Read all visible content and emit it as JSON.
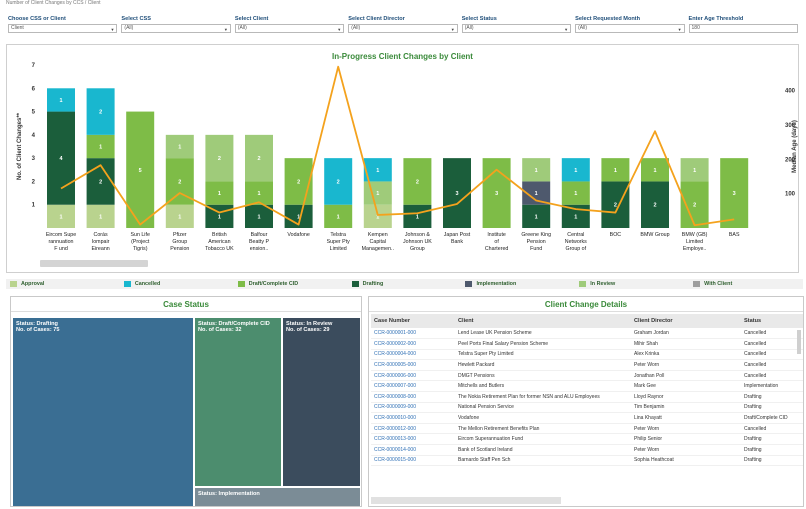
{
  "header": {
    "note": "Number of Client Changes by CCS / Client"
  },
  "filters": [
    {
      "label": "Choose CSS or Client",
      "value": "Client"
    },
    {
      "label": "Select CSS",
      "value": "(All)"
    },
    {
      "label": "Select Client",
      "value": "(All)"
    },
    {
      "label": "Select Client Director",
      "value": "(All)"
    },
    {
      "label": "Select Status",
      "value": "(All)"
    },
    {
      "label": "Select Requested Month",
      "value": "(All)"
    },
    {
      "label": "Enter Age Threshold",
      "value": "180"
    }
  ],
  "chart_data": {
    "type": "bar",
    "title": "In-Progress Client Changes by Client",
    "ylabel": "No. of Client Changes**",
    "y2label": "Median Age (days)",
    "ylim": [
      0,
      7
    ],
    "yticks": [
      1,
      2,
      3,
      4,
      5,
      6,
      7
    ],
    "y2lim": [
      0,
      475
    ],
    "y2ticks": [
      100,
      200,
      300,
      400
    ],
    "categories": [
      "Eircom Supe rannuation F und",
      "Corás Iompair Eireann",
      "Sun Life (Project Tigris)",
      "Pfizer Group Pension Scheme",
      "British American Tobacco UK",
      "Balfour Beatty P ension..",
      "Vodafone",
      "Telstra Super Pty Limited",
      "Kempen Capital Managemen..",
      "Johnson & Johnson UK Group Reti..",
      "Japan Post Bank",
      "Institute of Chartered Accountants",
      "Greene King Pension Fund",
      "Central Networks Group of th..",
      "BOC",
      "BMW Group",
      "BMW (GB) Limited Employe..",
      "BAS"
    ],
    "series": [
      {
        "name": "Approval",
        "color": "#b9d38e",
        "values": [
          1,
          1,
          0,
          1,
          0,
          0,
          0,
          0,
          1,
          0,
          0,
          0,
          0,
          0,
          0,
          0,
          0,
          0
        ]
      },
      {
        "name": "Drafting",
        "color": "#1b5e3b",
        "values": [
          4,
          2,
          0,
          0,
          1,
          1,
          1,
          0,
          0,
          1,
          3,
          0,
          1,
          1,
          2,
          2,
          0,
          0
        ]
      },
      {
        "name": "Draft/Complete CID",
        "color": "#7ebc47",
        "values": [
          0,
          1,
          5,
          2,
          1,
          1,
          2,
          1,
          0,
          2,
          0,
          3,
          0,
          1,
          1,
          1,
          2,
          3
        ]
      },
      {
        "name": "Implementation",
        "color": "#4e596d",
        "values": [
          0,
          0,
          0,
          0,
          0,
          0,
          0,
          0,
          0,
          0,
          0,
          0,
          1,
          0,
          0,
          0,
          0,
          0
        ]
      },
      {
        "name": "In Review",
        "color": "#9fcb7a",
        "values": [
          0,
          0,
          0,
          1,
          2,
          2,
          0,
          0,
          1,
          0,
          0,
          0,
          1,
          0,
          0,
          0,
          1,
          0
        ]
      },
      {
        "name": "Cancelled",
        "color": "#19b7cf",
        "values": [
          1,
          2,
          0,
          0,
          0,
          0,
          0,
          2,
          1,
          0,
          0,
          0,
          0,
          1,
          0,
          0,
          0,
          0
        ]
      }
    ],
    "line": {
      "name": "Median Age (days)",
      "color": "#f4a21d",
      "values": [
        115,
        183,
        10,
        102,
        45,
        75,
        10,
        470,
        38,
        43,
        70,
        170,
        80,
        55,
        45,
        282,
        8,
        25
      ]
    }
  },
  "legend": [
    {
      "label": "Approval",
      "color": "#b9d38e"
    },
    {
      "label": "Cancelled",
      "color": "#19b7cf"
    },
    {
      "label": "Draft/Complete CID",
      "color": "#7ebc47"
    },
    {
      "label": "Drafting",
      "color": "#1b5e3b"
    },
    {
      "label": "Implementation",
      "color": "#4e596d"
    },
    {
      "label": "In Review",
      "color": "#9fcb7a"
    },
    {
      "label": "With Client",
      "color": "#9e9e9e"
    }
  ],
  "case_status": {
    "title": "Case Status",
    "tiles": [
      {
        "status": "Status: Drafting",
        "cases": "No. of Cases: 75",
        "color": "#3a6e93"
      },
      {
        "status": "Status: Draft/Complete CID",
        "cases": "No. of Cases: 32",
        "color": "#4c8d6e"
      },
      {
        "status": "Status: In Review",
        "cases": "No. of Cases: 29",
        "color": "#3b4c5d"
      },
      {
        "status": "Status: Implementation",
        "cases": "",
        "color": "#7b8c96"
      }
    ]
  },
  "details": {
    "title": "Client Change Details",
    "columns": [
      "Case Number",
      "Client",
      "Client Director",
      "Status"
    ],
    "rows": [
      [
        "CCR-0000001-000",
        "Lend Lease UK Pension Scheme",
        "Graham Jordan",
        "Cancelled"
      ],
      [
        "CCR-0000002-000",
        "Peel Ports Final Salary Pension Scheme",
        "Mihir Shah",
        "Cancelled"
      ],
      [
        "CCR-0000004-000",
        "Telstra Super Pty Limited",
        "Alex Krinka",
        "Cancelled"
      ],
      [
        "CCR-0000005-000",
        "Hewlett Packard",
        "Peter Worn",
        "Cancelled"
      ],
      [
        "CCR-0000006-000",
        "DMGT Pensions",
        "Jonathan Poll",
        "Cancelled"
      ],
      [
        "CCR-0000007-000",
        "Mitchells and Butlers",
        "Mark Gee",
        "Implementation"
      ],
      [
        "CCR-0000008-000",
        "The Nokia Retirement Plan for former NSN and ALU Employees",
        "Lloyd Raynor",
        "Drafting"
      ],
      [
        "CCR-0000009-000",
        "National Pension Service",
        "Tim Benjamin",
        "Drafting"
      ],
      [
        "CCR-0000010-000",
        "Vodafone",
        "Lina Khayatt",
        "Draft/Complete CID"
      ],
      [
        "CCR-0000012-000",
        "The Mellon Retirement Benefits Plan",
        "Peter Worn",
        "Cancelled"
      ],
      [
        "CCR-0000013-000",
        "Eircom Superannuation Fund",
        "Philip Senior",
        "Drafting"
      ],
      [
        "CCR-0000014-000",
        "Bank of Scotland Ireland",
        "Peter Worn",
        "Drafting"
      ],
      [
        "CCR-0000015-000",
        "Barnardo Staff Pen Sch",
        "Sophia Heathcoat",
        "Drafting"
      ]
    ]
  }
}
